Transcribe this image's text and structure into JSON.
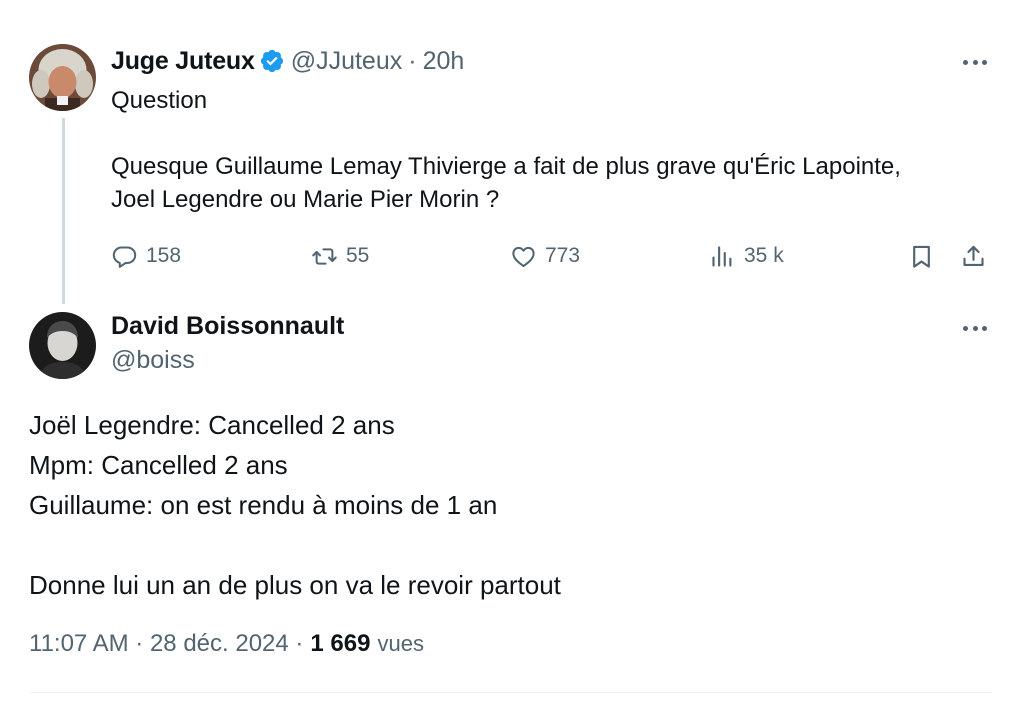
{
  "tweet1": {
    "author_name": "Juge Juteux",
    "handle": "@JJuteux",
    "separator": "·",
    "time": "20h",
    "text": "Question\n\nQuesque Guillaume Lemay Thivierge a fait de plus grave qu'Éric Lapointe,\nJoel Legendre ou Marie Pier Morin ?",
    "stats": {
      "replies": "158",
      "retweets": "55",
      "likes": "773",
      "views": "35 k"
    }
  },
  "tweet2": {
    "author_name": "David Boissonnault",
    "handle": "@boiss",
    "text": "Joël Legendre: Cancelled 2 ans\nMpm: Cancelled 2 ans\nGuillaume: on est rendu à moins de 1 an\n\nDonne lui un an de plus on va le revoir partout",
    "timestamp": "11:07 AM · 28 déc. 2024 ·",
    "view_count": "1 669",
    "views_label": "vues"
  },
  "colors": {
    "text": "#0f1419",
    "muted": "#536471",
    "verified": "#1d9bf0",
    "thread_line": "#cfd9de"
  },
  "icons": [
    "verified-badge-icon",
    "more-icon",
    "reply-icon",
    "retweet-icon",
    "like-icon",
    "views-icon",
    "bookmark-icon",
    "share-icon"
  ]
}
